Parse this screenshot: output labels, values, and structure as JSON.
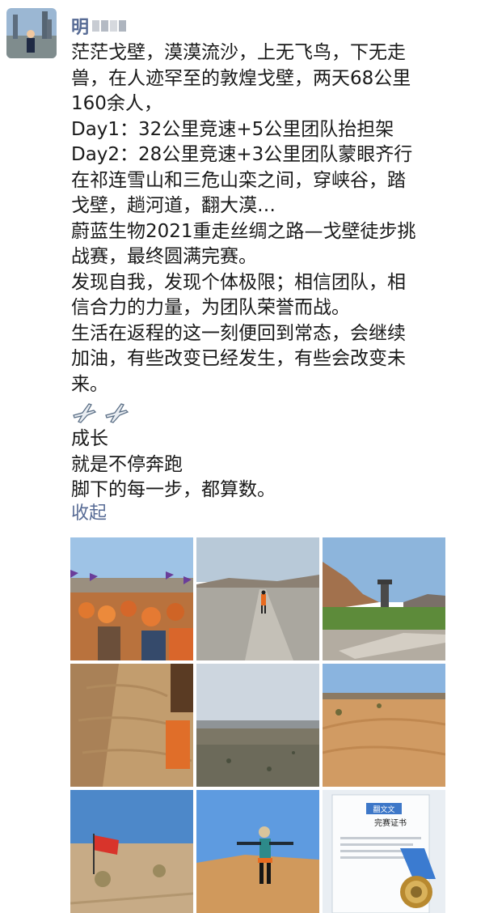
{
  "user": {
    "name_visible": "明",
    "avatar_icon": "avatar-photo"
  },
  "post": {
    "lines": [
      "茫茫戈壁，漠漠流沙，上无飞鸟，下无走",
      "兽，在人迹罕至的敦煌戈壁，两天68公里",
      "160余人，",
      "Day1：32公里竞速+5公里团队抬担架",
      "Day2：28公里竞速+3公里团队蒙眼齐行",
      "在祁连雪山和三危山栾之间，穿峡谷，踏",
      "戈壁，趟河道，翻大漠…",
      "蔚蓝生物2021重走丝绸之路—戈壁徒步挑",
      "战赛，最终圆满完赛。",
      "发现自我，发现个体极限；相信团队，相",
      "信合力的力量，为团队荣誉而战。",
      "生活在返程的这一刻便回到常态，会继续",
      "加油，有些改变已经发生，有些会改变未",
      "来。"
    ],
    "emoji": [
      "airplane-emoji",
      "airplane-emoji"
    ],
    "tail_lines": [
      "成长",
      "就是不停奔跑",
      "脚下的每一步，都算数。"
    ],
    "collapse_label": "收起"
  },
  "photos": [
    {
      "name": "photo-crowd-flags"
    },
    {
      "name": "photo-runner-road"
    },
    {
      "name": "photo-tower-river"
    },
    {
      "name": "photo-sand-slope"
    },
    {
      "name": "photo-plain-horizon"
    },
    {
      "name": "photo-sand-dunes"
    },
    {
      "name": "photo-red-flag-desert"
    },
    {
      "name": "photo-hiker-dune"
    },
    {
      "name": "photo-certificate-medal"
    }
  ],
  "certificate": {
    "title": "完赛证书",
    "label": "翻文文"
  },
  "colors": {
    "link_blue": "#576b95",
    "text": "#191919",
    "background": "#ffffff"
  }
}
